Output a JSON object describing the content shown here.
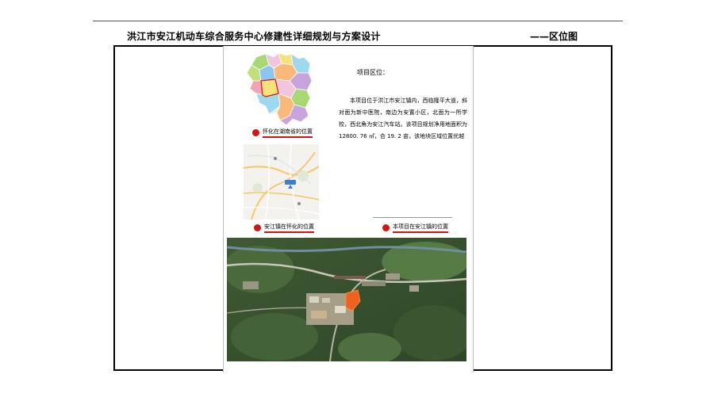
{
  "header": {
    "title": "洪江市安江机动车综合服务中心修建性详细规划与方案设计",
    "section": "——区位图"
  },
  "description": {
    "heading": "项目区位：",
    "body": "本项目位于洪江市安江镇内，西临隆平大道，斜对面为新中医院，南边为安置小区，北面为一所学校，西北角为安江汽车站。该项目规划净用地面积为 12800. 76 ㎡，合 19. 2 亩，该地块区域位置优越"
  },
  "captions": {
    "province": "怀化在湖南省的位置",
    "city": "安江镇在怀化的位置",
    "project": "本项目在安江镇的位置"
  },
  "colors": {
    "accent_red": "#d11414",
    "site_orange": "#f0601e",
    "map_blue": "#3b7ddd"
  }
}
